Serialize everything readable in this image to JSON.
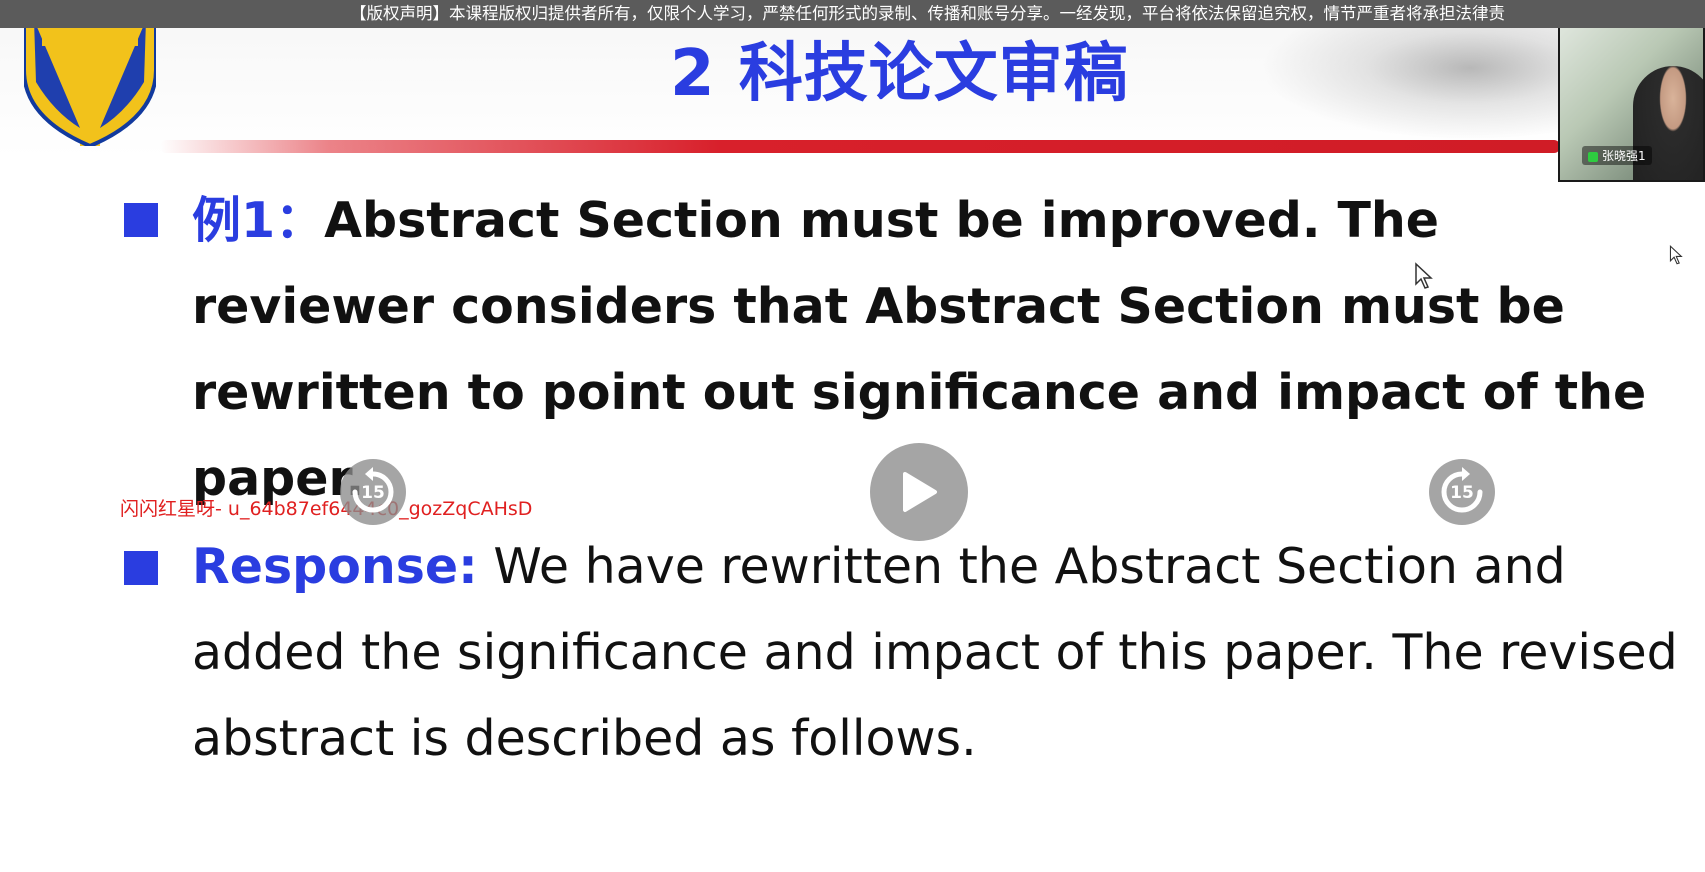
{
  "banner": {
    "text": "【版权声明】本课程版权归提供者所有，仅限个人学习，严禁任何形式的录制、传播和账号分享。一经发现，平台将依法保留追究权，情节严重者将承担法律责"
  },
  "slide": {
    "title": "2 科技论文审稿",
    "example": {
      "label": "例1：",
      "text": "Abstract Section must be improved. The reviewer considers that Abstract Section must be rewritten to point out significance and impact of the paper."
    },
    "response": {
      "label": "Response:",
      "text": "We have rewritten the Abstract Section and added the significance and impact of this paper. The revised abstract is described as follows."
    }
  },
  "webcam": {
    "name": "张晓强1"
  },
  "watermark": {
    "text": "闪闪红星呀- u_64b87ef6444c0_gozZqCAHsD"
  },
  "player": {
    "rewind_label": "15",
    "forward_label": "15",
    "play_icon": "play-icon"
  },
  "colors": {
    "accent": "#2a3de0",
    "rule": "#d8202b",
    "watermark": "#e02020"
  }
}
